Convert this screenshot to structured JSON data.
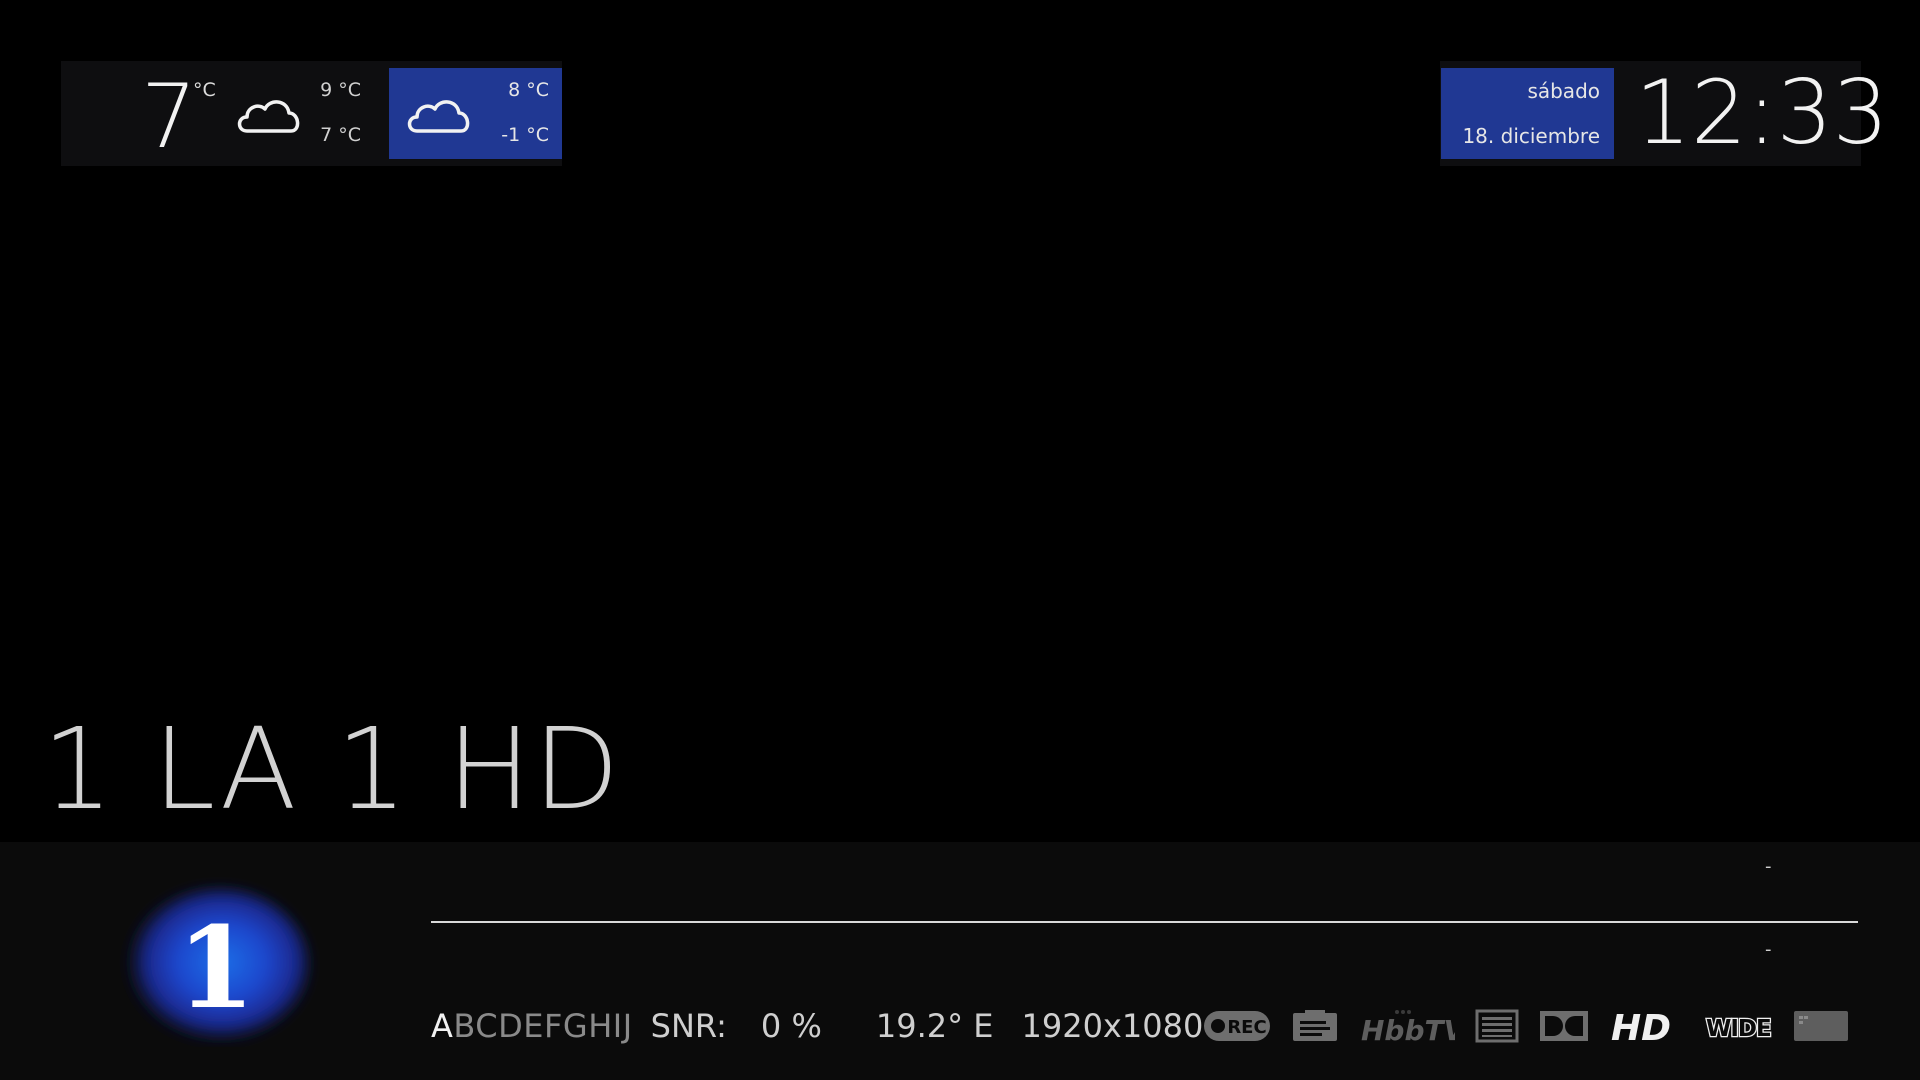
{
  "weather": {
    "current_temp": "7",
    "current_unit": "°C",
    "current_condition_icon": "cloud-icon",
    "today_high": "9 °C",
    "today_low": "7 °C",
    "tomorrow_condition_icon": "cloud-icon",
    "tomorrow_high": "8 °C",
    "tomorrow_low": "-1 °C"
  },
  "datetime": {
    "day": "sábado",
    "date": "18. diciembre",
    "time": "12:33"
  },
  "channel": {
    "name": "1 LA 1 HD",
    "logo_text": "1"
  },
  "infobar": {
    "now_time": "-",
    "next_time": "-",
    "caids_first": "A",
    "caids_rest": "BCDEFGHIJ",
    "snr_label": "SNR:",
    "snr_value": "0 %",
    "orbital_position": "19.2° E",
    "resolution": "1920x1080",
    "status_icons": [
      "rec-icon",
      "epg-info-icon",
      "hbbtv-icon",
      "teletext-icon",
      "dolby-icon",
      "hd-icon",
      "widescreen-icon",
      "subtitles-icon"
    ],
    "hbbtv_label": "HbbTV",
    "hd_label": "HD",
    "wide_label": "WIDE",
    "rec_label": "REC"
  },
  "colors": {
    "accent_blue": "#203893",
    "panel_bg": "#0e0e10",
    "infobar_bg": "#0b0b0b",
    "logo_blue": "#1f4fd1"
  }
}
